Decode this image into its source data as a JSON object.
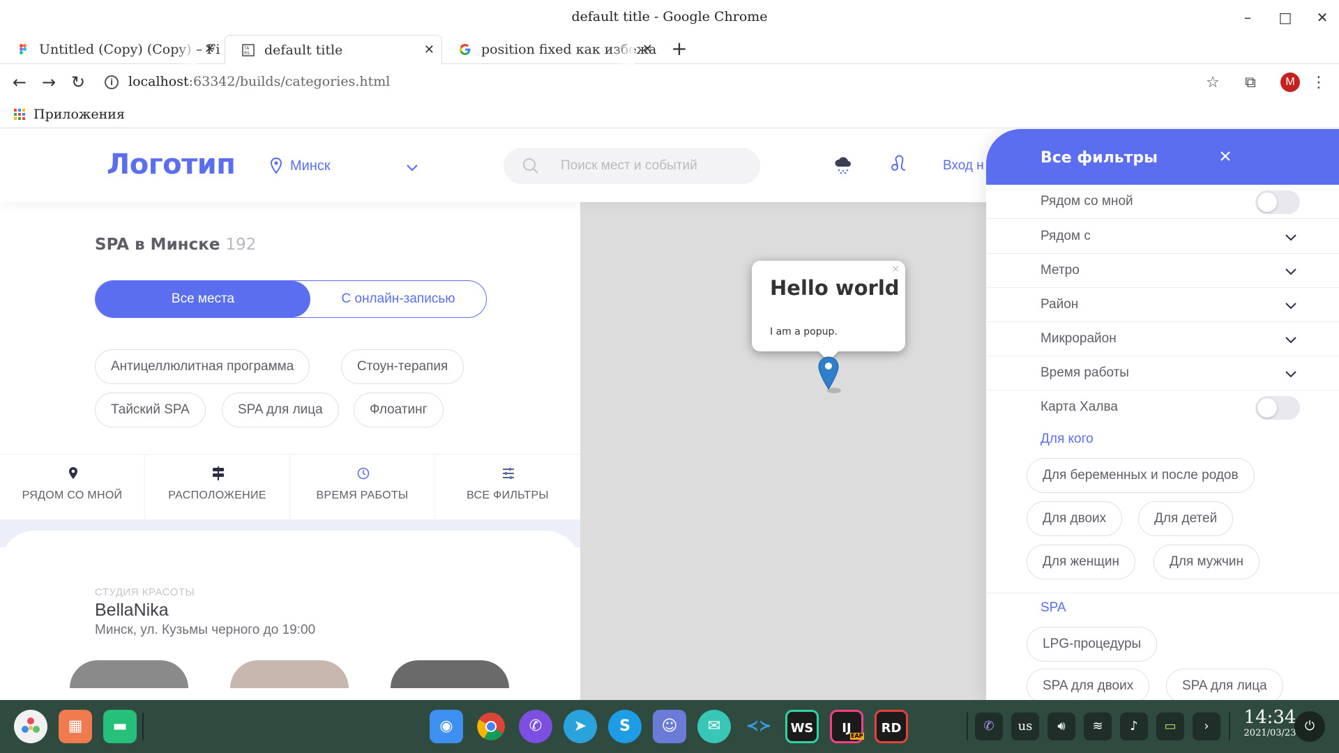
{
  "window": {
    "title": "default title - Google Chrome",
    "minimize": "–",
    "maximize": "□",
    "close": "✕"
  },
  "tabs": [
    {
      "label": "Untitled (Copy) (Copy) – Fi",
      "icon": "figma-icon"
    },
    {
      "label": "default title",
      "icon": "page-icon",
      "active": true
    },
    {
      "label": "position fixed как избежа",
      "icon": "google-icon"
    }
  ],
  "toolbar": {
    "url_host": "localhost",
    "url_rest": ":63342/builds/categories.html",
    "profile_initial": "M"
  },
  "bookmarks": {
    "apps_label": "Приложения"
  },
  "header": {
    "logo": "Логотип",
    "city": "Минск",
    "search_placeholder": "Поиск мест и событий",
    "login": "Вход н"
  },
  "listing": {
    "title": "SPA в Минске",
    "count": "192",
    "segment_all": "Все места",
    "segment_online": "С онлайн-записью",
    "chips": [
      "Антицеллюлитная программа",
      "Стоун-терапия",
      "Тайский SPA",
      "SPA для лица",
      "Флоатинг"
    ],
    "filterbar": [
      "РЯДОМ СО МНОЙ",
      "РАСПОЛОЖЕНИЕ",
      "ВРЕМЯ РАБОТЫ",
      "ВСЕ ФИЛЬТРЫ"
    ],
    "card": {
      "category": "СТУДИЯ КРАСОТЫ",
      "name": "BellaNika",
      "address": "Минск, ул. Кузьмы черного до 19:00"
    }
  },
  "map": {
    "popup_title": "Hello world",
    "popup_body": "I am a popup.",
    "popup_close": "×"
  },
  "panel": {
    "title": "Все фильтры",
    "rows": [
      "Рядом со мной",
      "Рядом с",
      "Метро",
      "Район",
      "Микрорайон",
      "Время работы",
      "Карта Халва"
    ],
    "section_for_whom": "Для кого",
    "for_whom_chips": [
      "Для беременных и после родов",
      "Для двоих",
      "Для детей",
      "Для женщин",
      "Для мужчин"
    ],
    "section_spa": "SPA",
    "spa_chips": [
      "LPG-процедуры",
      "SPA для двоих",
      "SPA для лица"
    ]
  },
  "taskbar": {
    "lang": "us",
    "time": "14:34",
    "date": "2021/03/23",
    "jetbrains_ws": "WS",
    "jetbrains_ij": "IJ",
    "jetbrains_eap": "EAP",
    "jetbrains_rd": "RD"
  },
  "colors": {
    "accent": "#5b6ef0",
    "map_bg": "#dcdcdc",
    "taskbar_bg": "#2f4a3f"
  }
}
